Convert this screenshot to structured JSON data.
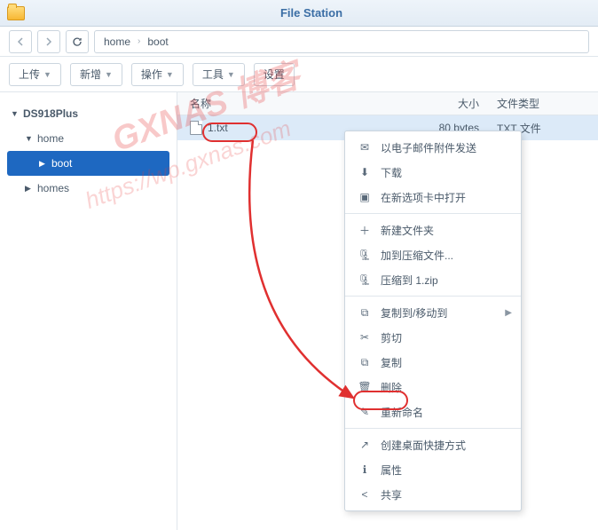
{
  "app": {
    "title": "File Station"
  },
  "breadcrumb": {
    "items": [
      "home",
      "boot"
    ]
  },
  "toolbar": {
    "upload": "上传",
    "new": "新增",
    "actions": "操作",
    "tools": "工具",
    "settings": "设置"
  },
  "tree": {
    "root": "DS918Plus",
    "items": [
      {
        "label": "home",
        "active": false
      },
      {
        "label": "boot",
        "active": true
      },
      {
        "label": "homes",
        "active": false
      }
    ]
  },
  "columns": {
    "name": "名称",
    "size": "大小",
    "type": "文件类型"
  },
  "files": [
    {
      "name": "1.txt",
      "size": "80 bytes",
      "type": "TXT 文件"
    }
  ],
  "contextMenu": {
    "emailSend": "以电子邮件附件发送",
    "download": "下载",
    "openNewTab": "在新选项卡中打开",
    "newFolder": "新建文件夹",
    "addCompress": "加到压缩文件...",
    "compressTo": "压缩到 1.zip",
    "copyMoveTo": "复制到/移动到",
    "cut": "剪切",
    "copy": "复制",
    "delete": "删除",
    "rename": "重新命名",
    "createShortcut": "创建桌面快捷方式",
    "properties": "属性",
    "share": "共享"
  },
  "watermark": {
    "line1": "GXNAS 博客",
    "line2": "https://wp.gxnas.com"
  }
}
